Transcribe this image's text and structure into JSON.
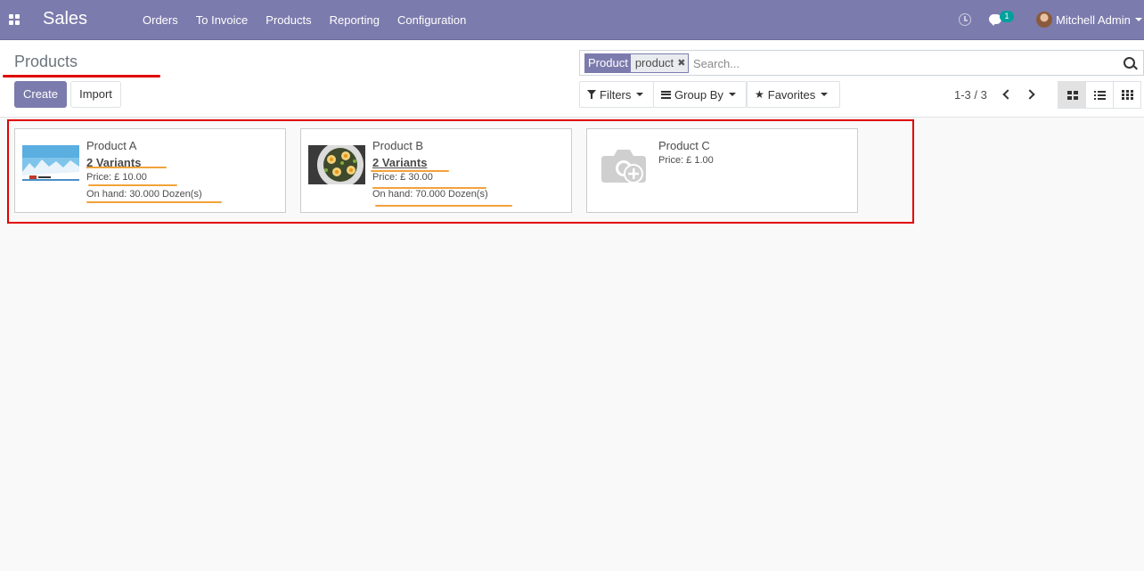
{
  "navbar": {
    "app_title": "Sales",
    "menu": [
      "Orders",
      "To Invoice",
      "Products",
      "Reporting",
      "Configuration"
    ],
    "chat_count": "1",
    "user_name": "Mitchell Admin"
  },
  "control_panel": {
    "title": "Products",
    "create_label": "Create",
    "import_label": "Import",
    "search": {
      "facet_label": "Product",
      "facet_value": "product",
      "placeholder": "Search..."
    },
    "filters_label": "Filters",
    "groupby_label": "Group By",
    "favorites_label": "Favorites",
    "pager": "1-3 / 3",
    "active_view": "kanban"
  },
  "products": [
    {
      "name": "Product A",
      "variants": "2 Variants",
      "price": "Price: £ 10.00",
      "on_hand": "On hand: 30.000 Dozen(s)",
      "image": "winter-landscape"
    },
    {
      "name": "Product B",
      "variants": "2 Variants",
      "price": "Price: £ 30.00",
      "on_hand": "On hand: 70.000 Dozen(s)",
      "image": "food-plate"
    },
    {
      "name": "Product C",
      "price": "Price: £ 1.00",
      "image": "camera-placeholder-icon"
    }
  ],
  "colors": {
    "brand": "#7c7bad",
    "highlight_red": "#e00000",
    "annotation_orange": "#f2a23a",
    "badge": "#00a09d"
  }
}
